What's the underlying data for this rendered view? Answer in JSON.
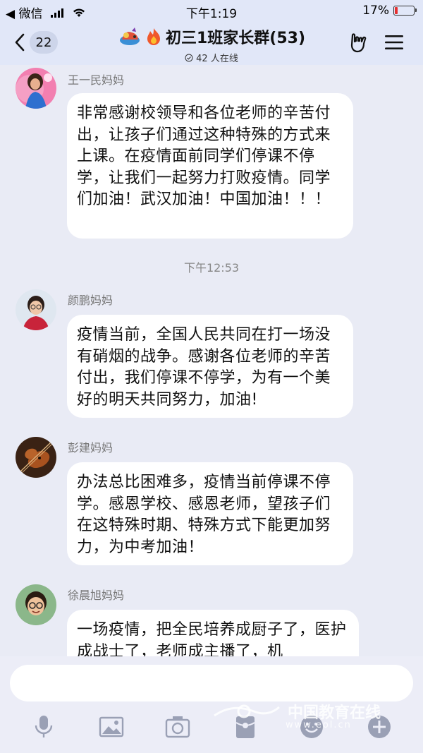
{
  "status_bar": {
    "carrier": "◀ 微信",
    "time": "下午1:19",
    "battery_percent": "17%",
    "battery_level": 0.17
  },
  "header": {
    "back_count": "22",
    "title": "初三1班家长群(53)",
    "online": "42 人在线"
  },
  "messages": [
    {
      "sender": "王一民妈妈",
      "text": "非常感谢校领导和各位老师的辛苦付出，让孩子们通过这种特殊的方式来上课。在疫情面前同学们停课不停学，让我们一起努力打败疫情。同学们加油！武汉加油！中国加油！！！"
    },
    {
      "timestamp": "下午12:53"
    },
    {
      "sender": "颜鹏妈妈",
      "text": "疫情当前，全国人民共同在打一场没有硝烟的战争。感谢各位老师的辛苦付出，我们停课不停学，为有一个美好的明天共同努力，加油!"
    },
    {
      "sender": "彭建妈妈",
      "text": "办法总比困难多，疫情当前停课不停学。感恩学校、感恩老师，望孩子们在这特殊时期、特殊方式下能更加努力，为中考加油！"
    },
    {
      "sender": "徐晨旭妈妈",
      "text": "一场疫情，把全民培养成厨子了，医护成战士了，老师成主播了，机"
    }
  ],
  "input": {
    "value": ""
  },
  "toolbar_icons": [
    "microphone-icon",
    "image-icon",
    "camera-icon",
    "red-packet-icon",
    "emoji-icon",
    "plus-icon"
  ],
  "watermark": {
    "text": "中国教育在线",
    "sub": "www.eol.cn"
  },
  "colors": {
    "background": "#e9ebf5",
    "header": "#e1e7f8",
    "bubble": "#ffffff",
    "battery_low": "#e53030"
  }
}
